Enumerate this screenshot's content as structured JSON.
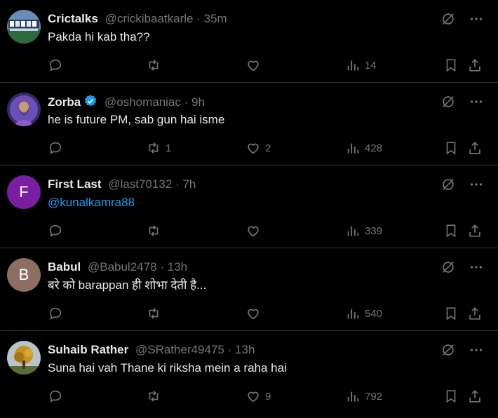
{
  "replies": [
    {
      "name": "Crictalks",
      "handle": "@crickibaatkarle",
      "separator": "·",
      "time": "35m",
      "text": "Pakda hi kab tha??",
      "verified": false,
      "avatar": "cricket-stadium-avatar",
      "replies_count": "",
      "reposts": "",
      "likes": "",
      "views": "14"
    },
    {
      "name": "Zorba",
      "handle": "@oshomaniac",
      "separator": "·",
      "time": "9h",
      "text": "he is future PM, sab gun hai isme",
      "verified": true,
      "avatar": "bearded-man-purple-robe-avatar",
      "replies_count": "",
      "reposts": "1",
      "likes": "2",
      "views": "428"
    },
    {
      "name": "First Last",
      "handle": "@last70132",
      "separator": "·",
      "time": "7h",
      "text": "@kunalkamra88",
      "verified": false,
      "avatar_letter": "F",
      "avatar_color": "#7b1fa2",
      "replies_count": "",
      "reposts": "",
      "likes": "",
      "views": "339"
    },
    {
      "name": "Babul",
      "handle": "@Babul2478",
      "separator": "·",
      "time": "13h",
      "text": "बरे को barappan ही शोभा देती है...",
      "verified": false,
      "avatar_letter": "B",
      "avatar_color": "#8d6e63",
      "replies_count": "",
      "reposts": "",
      "likes": "",
      "views": "540"
    },
    {
      "name": "Suhaib Rather",
      "handle": "@SRather49475",
      "separator": "·",
      "time": "13h",
      "text": "Suna hai vah Thane ki riksha mein a raha hai",
      "verified": false,
      "avatar": "autumn-tree-avatar",
      "replies_count": "",
      "reposts": "",
      "likes": "9",
      "views": "792"
    }
  ],
  "colors": {
    "background": "#000000",
    "text": "#e7e9ea",
    "muted": "#71767b",
    "link": "#1d9bf0",
    "border": "#2f3336",
    "verified": "#1d9bf0"
  },
  "icons": [
    "grok-icon",
    "more-icon",
    "reply-icon",
    "repost-icon",
    "like-icon",
    "views-icon",
    "bookmark-icon",
    "share-icon",
    "verified-badge-icon"
  ]
}
